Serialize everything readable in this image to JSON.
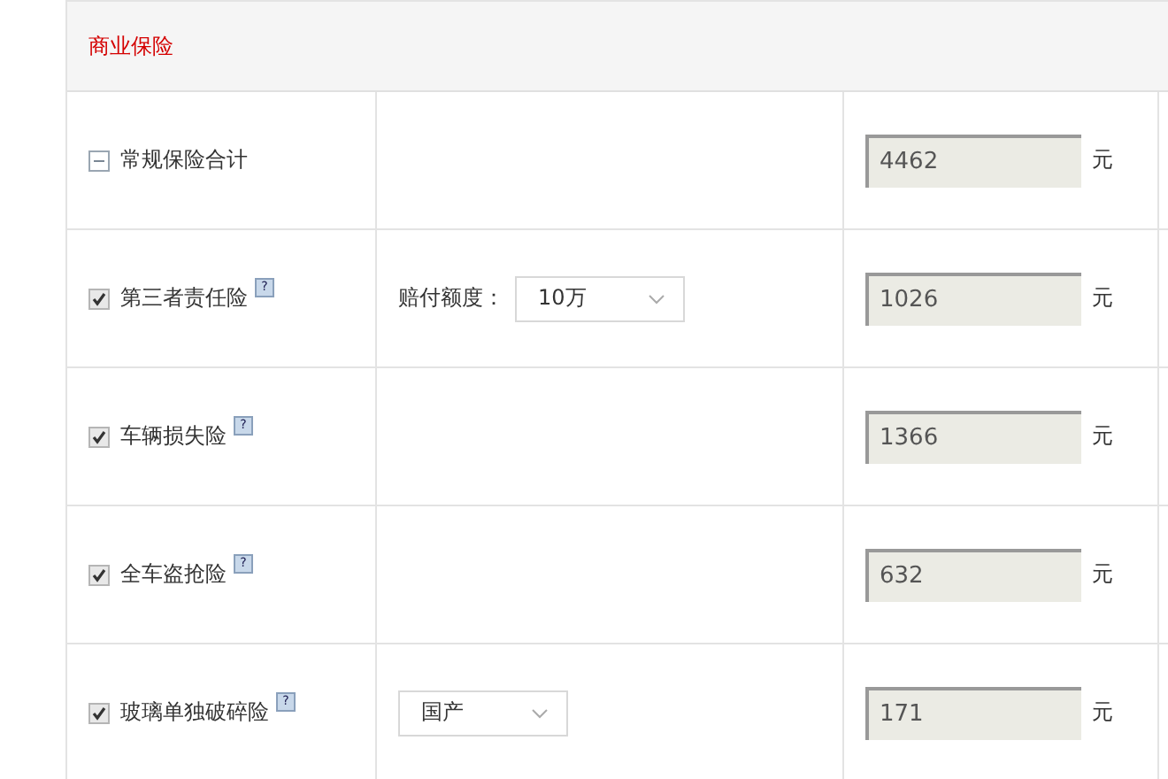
{
  "section_title": "商业保险",
  "rows": [
    {
      "kind": "group",
      "name": "常规保险合计",
      "expanded": true,
      "amount": "4462",
      "unit": "元"
    },
    {
      "kind": "item",
      "name": "第三者责任险",
      "checked": true,
      "help": "?",
      "option_label": "赔付额度：",
      "option_value": "10万",
      "amount": "1026",
      "unit": "元"
    },
    {
      "kind": "item",
      "name": "车辆损失险",
      "checked": true,
      "help": "?",
      "amount": "1366",
      "unit": "元"
    },
    {
      "kind": "item",
      "name": "全车盗抢险",
      "checked": true,
      "help": "?",
      "amount": "632",
      "unit": "元"
    },
    {
      "kind": "item",
      "name": "玻璃单独破碎险",
      "checked": true,
      "help": "?",
      "option_value": "国产",
      "amount": "171",
      "unit": "元"
    }
  ]
}
